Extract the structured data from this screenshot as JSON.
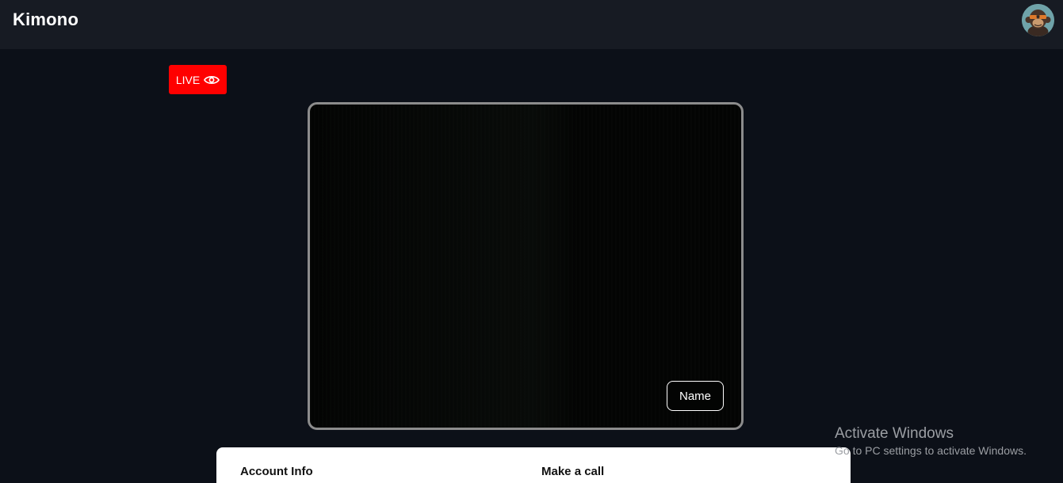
{
  "header": {
    "brand": "Kimono",
    "avatar_icon": "monkey-avatar-icon"
  },
  "live_badge": {
    "label": "LIVE",
    "icon": "eye-icon",
    "color": "#ff0000"
  },
  "video": {
    "name_label": "Name"
  },
  "panel": {
    "account_title": "Account Info",
    "call_title": "Make a call"
  },
  "watermark": {
    "title": "Activate Windows",
    "subtitle": "Go to PC settings to activate Windows."
  }
}
